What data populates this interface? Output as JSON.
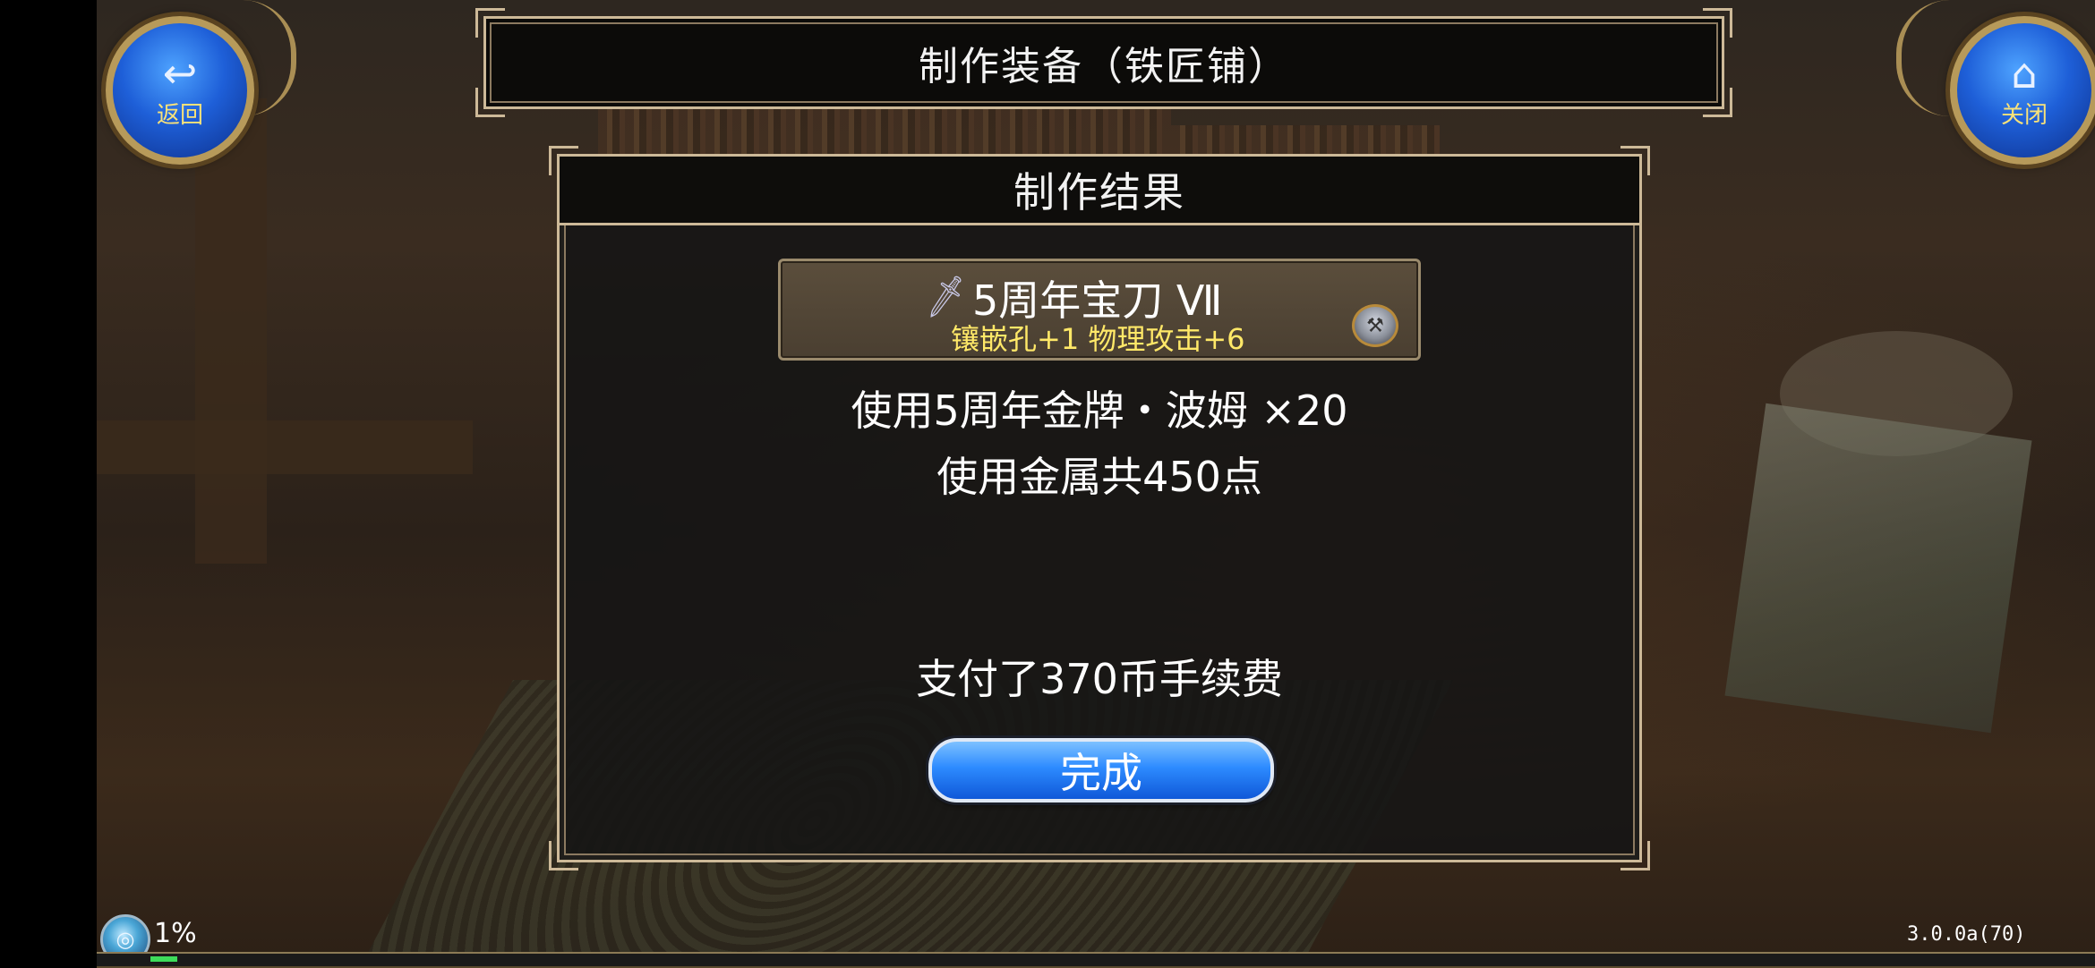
{
  "header": {
    "title": "制作装备（铁匠铺）",
    "back_label": "返回",
    "close_label": "关闭",
    "back_icon": "↩",
    "close_icon": "⌂"
  },
  "dialog": {
    "title": "制作结果",
    "item": {
      "name": "5周年宝刀 Ⅶ",
      "stats": "镶嵌孔+1 物理攻击+6",
      "sword_icon": "sword-icon",
      "anvil_icon": "anvil-icon"
    },
    "material_line": "使用5周年金牌・波姆 ×20",
    "metal_line": "使用金属共450点",
    "fee_line": "支付了370币手续费",
    "done_label": "完成"
  },
  "hud": {
    "percent": "1%",
    "progress": 0.01,
    "version": "3.0.0a(70)"
  },
  "colors": {
    "accent_blue": "#2d8bff",
    "gold_text": "#ffe868",
    "frame_gold": "#cdb998"
  }
}
